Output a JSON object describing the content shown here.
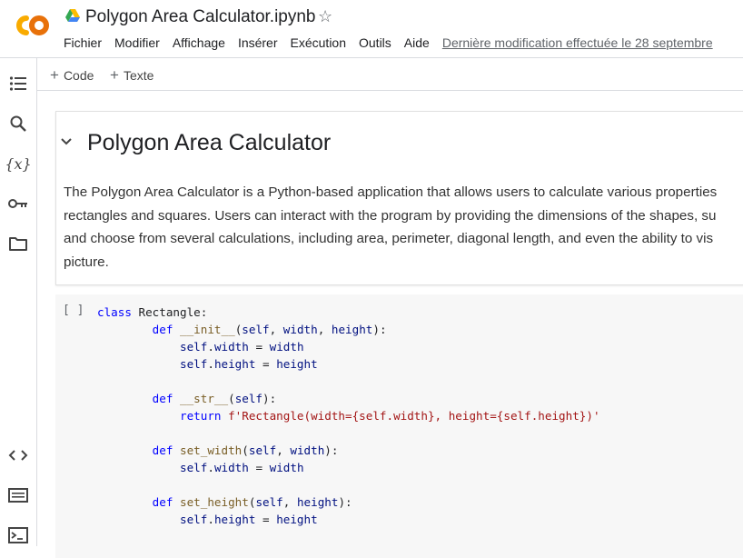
{
  "header": {
    "title": "Polygon Area Calculator.ipynb",
    "menu": [
      "Fichier",
      "Modifier",
      "Affichage",
      "Insérer",
      "Exécution",
      "Outils",
      "Aide"
    ],
    "last_edit": "Dernière modification effectuée le 28 septembre"
  },
  "rail": {
    "icons": [
      "table-of-contents-icon",
      "search-icon",
      "variables-icon",
      "key-icon",
      "folder-icon",
      "code-snippets-icon",
      "command-palette-icon",
      "terminal-icon"
    ]
  },
  "toolbar": {
    "add_code": "Code",
    "add_text": "Texte"
  },
  "text_cell": {
    "heading": "Polygon Area Calculator",
    "paragraph_lines": [
      "The Polygon Area Calculator is a Python-based application that allows users to calculate various properties",
      "rectangles and squares. Users can interact with the program by providing the dimensions of the shapes, su",
      "and choose from several calculations, including area, perimeter, diagonal length, and even the ability to vis",
      "picture."
    ]
  },
  "code_cell": {
    "run_label": "[ ]",
    "lines": [
      "class Rectangle:",
      "        def __init__(self, width, height):",
      "            self.width = width",
      "            self.height = height",
      "",
      "        def __str__(self):",
      "            return f'Rectangle(width={self.width}, height={self.height})'",
      "",
      "        def set_width(self, width):",
      "            self.width = width",
      "",
      "        def set_height(self, height):",
      "            self.height = height"
    ]
  },
  "colors": {
    "logo_orange": "#f9ab00",
    "logo_dark_orange": "#e8710a",
    "keyword": "#0000ff",
    "string": "#a31515",
    "function": "#795e26",
    "self": "#001080"
  }
}
